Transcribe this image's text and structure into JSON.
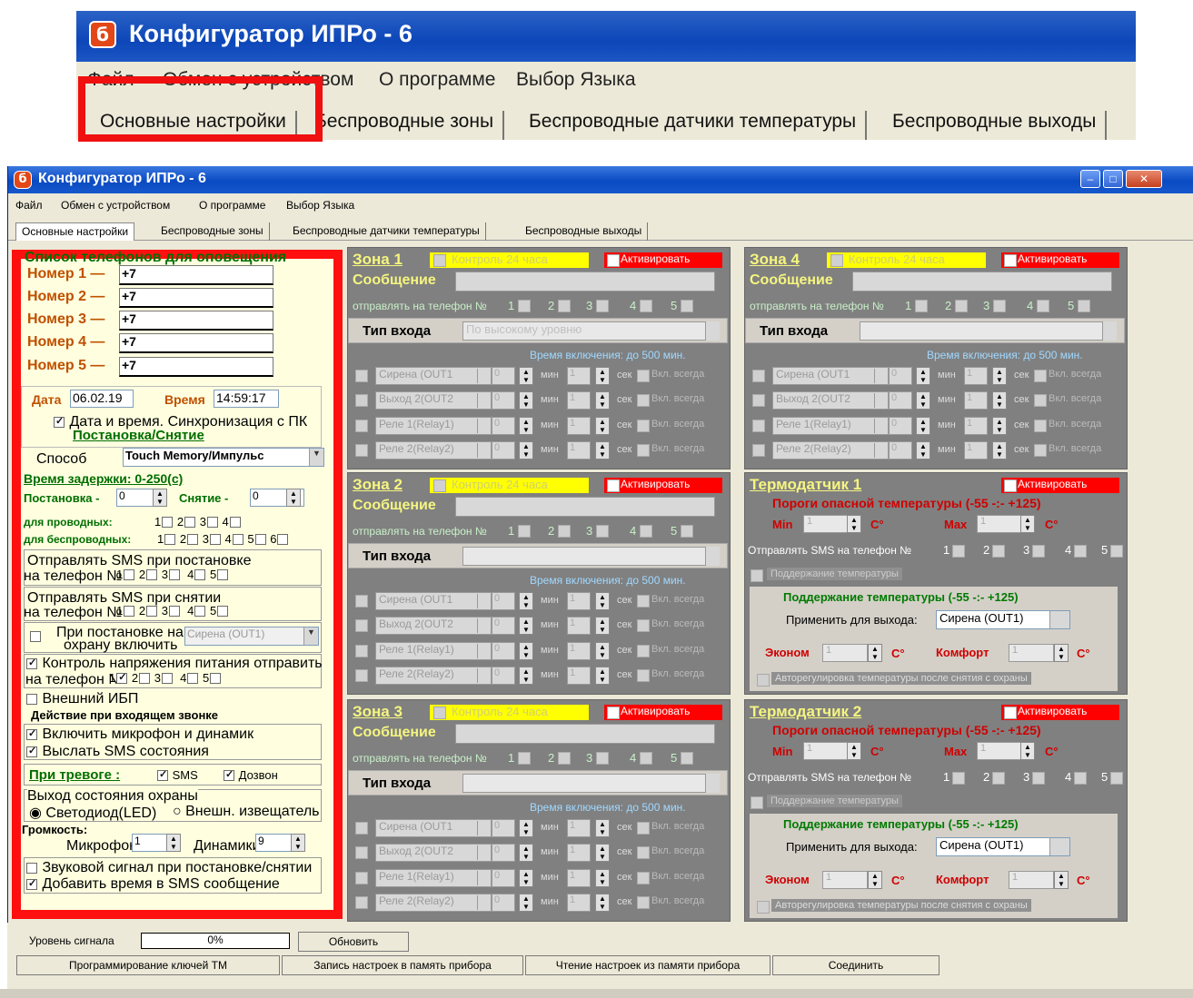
{
  "zoom": {
    "title": "Конфигуратор ИПРо - 6",
    "menu": [
      "Файл",
      "Обмен с устройством",
      "О программе",
      "Выбор Языка"
    ],
    "tabs": [
      "Основные настройки",
      "Беспроводные зоны",
      "Беспроводные датчики температуры",
      "Беспроводные выходы"
    ]
  },
  "window": {
    "title": "Конфигуратор ИПРо - 6",
    "menu": [
      "Файл",
      "Обмен с устройством",
      "О программе",
      "Выбор Языка"
    ],
    "tabs": [
      "Основные настройки",
      "Беспроводные зоны",
      "Беспроводные датчики температуры",
      "Беспроводные выходы"
    ]
  },
  "left": {
    "phones_title": "Список телефонов для оповещения",
    "phones": [
      {
        "label": "Номер 1 —",
        "value": "+7"
      },
      {
        "label": "Номер 2 —",
        "value": "+7"
      },
      {
        "label": "Номер 3 —",
        "value": "+7"
      },
      {
        "label": "Номер 4 —",
        "value": "+7"
      },
      {
        "label": "Номер 5 —",
        "value": "+7"
      }
    ],
    "date_label": "Дата",
    "date_value": "06.02.19",
    "time_label": "Время",
    "time_value": "14:59:17",
    "sync_label": "Дата и время. Синхронизация с ПК",
    "arm_title": "Постановка/Снятие",
    "method_label": "Способ",
    "method_value": "Touch Memory/Импульс",
    "delay_title": "Время задержки: 0-250(с)",
    "arm_label": "Постановка -",
    "arm_value": "0",
    "disarm_label": "Снятие -",
    "disarm_value": "0",
    "wired_label": "для проводных:",
    "wireless_label": "для беспроводных:",
    "sms_arm_line1": "Отправлять SMS при постановке",
    "sms_arm_line2": "на телефон №",
    "sms_disarm_line1": "Отправлять SMS при снятии",
    "sms_disarm_line2": "на телефон №",
    "on_arm_line1": "При постановке на",
    "on_arm_line2": "охрану включить",
    "on_arm_value": "Сирена (OUT1)",
    "power_line1": "Контроль напряжения питания отправить",
    "power_line2": "на телефон №",
    "ups_label": "Внешний ИБП",
    "call_title": "Действие при входящем звонке",
    "call_mic": "Включить микрофон и динамик",
    "call_sms": "Выслать SMS состояния",
    "alarm_title": "При тревоге :",
    "alarm_sms": "SMS",
    "alarm_call": "Дозвон",
    "out_title": "Выход состояния охраны",
    "out_led": "Светодиод(LED)",
    "out_ext": "Внешн. извещатель",
    "volume_title": "Громкость:",
    "mic_label": "Микрофон",
    "mic_value": "1",
    "spk_label": "Динамики",
    "spk_value": "9",
    "sound_label": "Звуковой сигнал при постановке/снятии",
    "time_sms_label": "Добавить время в SMS сообщение"
  },
  "zone_common": {
    "k24": "Контроль 24 часа",
    "activate": "Активировать",
    "message": "Сообщение",
    "send_to": "отправлять на телефон №",
    "input_type": "Тип входа",
    "on_time": "Время включения: до 500 мин.",
    "min": "мин",
    "sec": "сек",
    "always": "Вкл. всегда",
    "outputs": [
      "Сирена (OUT1",
      "Выход 2(OUT2",
      "Реле 1(Relay1)",
      "Реле 2(Relay2)"
    ],
    "zero": "0",
    "one": "1"
  },
  "zones": [
    {
      "title": "Зона 1",
      "type_value": "По высокому уровню"
    },
    {
      "title": "Зона 2",
      "type_value": ""
    },
    {
      "title": "Зона 3",
      "type_value": ""
    },
    {
      "title": "Зона 4",
      "type_value": ""
    }
  ],
  "thermo_common": {
    "activate": "Активировать",
    "thresholds": "Пороги опасной температуры (-55 -:- +125)",
    "min": "Min",
    "max": "Max",
    "deg": "С°",
    "send_to": "Отправлять SMS на телефон №",
    "support": "Поддержание температуры",
    "support_range": "Поддержание температуры (-55 -:- +125)",
    "apply": "Применить для выхода:",
    "apply_value": "Сирена (OUT1)",
    "econom": "Эконом",
    "comfort": "Комфорт",
    "auto": "Авторегулировка температуры после снятия с охраны",
    "one": "1"
  },
  "thermos": [
    {
      "title": "Термодатчик 1"
    },
    {
      "title": "Термодатчик 2"
    }
  ],
  "bottom": {
    "signal_label": "Уровень сигнала",
    "signal_value": "0%",
    "refresh": "Обновить",
    "prog_keys": "Программирование ключей ТМ",
    "write": "Запись настроек в память прибора",
    "read": "Чтение настроек из памяти прибора",
    "connect": "Соединить"
  },
  "colors": {
    "red_frame": "#ff1010",
    "zone_bg": "#808080",
    "yellow": "#ffff00",
    "title_blue": "#0c46b8"
  }
}
